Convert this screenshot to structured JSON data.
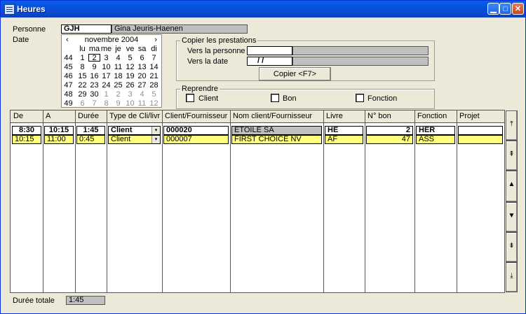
{
  "window": {
    "title": "Heures"
  },
  "form": {
    "personne_label": "Personne",
    "personne_code": "GJH",
    "personne_name": "Gina Jeuris-Haenen",
    "date_label": "Date"
  },
  "calendar": {
    "month_title": "novembre 2004",
    "prev": "‹",
    "next": "›",
    "day_headers": [
      "lu",
      "ma",
      "me",
      "je",
      "ve",
      "sa",
      "di"
    ],
    "weeks": [
      {
        "wk": "44",
        "days": [
          "1",
          "2",
          "3",
          "4",
          "5",
          "6",
          "7"
        ]
      },
      {
        "wk": "45",
        "days": [
          "8",
          "9",
          "10",
          "11",
          "12",
          "13",
          "14"
        ]
      },
      {
        "wk": "46",
        "days": [
          "15",
          "16",
          "17",
          "18",
          "19",
          "20",
          "21"
        ]
      },
      {
        "wk": "47",
        "days": [
          "22",
          "23",
          "24",
          "25",
          "26",
          "27",
          "28"
        ]
      },
      {
        "wk": "48",
        "days": [
          "29",
          "30",
          "1",
          "2",
          "3",
          "4",
          "5"
        ]
      },
      {
        "wk": "49",
        "days": [
          "6",
          "7",
          "8",
          "9",
          "10",
          "11",
          "12"
        ]
      }
    ],
    "selected_day": "2"
  },
  "copier": {
    "title": "Copier les prestations",
    "vers_personne_label": "Vers la personne",
    "vers_personne_value": "",
    "vers_date_label": "Vers la date",
    "vers_date_value": "/  /",
    "button": "Copier <F7>"
  },
  "reprendre": {
    "title": "Reprendre",
    "client": "Client",
    "bon": "Bon",
    "fonction": "Fonction"
  },
  "table": {
    "headers": [
      "De",
      "A",
      "Durée",
      "Type de Cli/livr",
      "Client/Fournisseur",
      "Nom client/Fournisseur",
      "Livre",
      "N° bon",
      "Fonction",
      "Projet"
    ],
    "rows": [
      {
        "de": "8:30",
        "a": "10:15",
        "duree": "1:45",
        "type": "Client",
        "client": "000020",
        "nom": "ETOILE SA",
        "livre": "HE",
        "bon": "2",
        "fonction": "HER",
        "projet": ""
      },
      {
        "de": "10:15",
        "a": "11:00",
        "duree": "0:45",
        "type": "Client",
        "client": "000007",
        "nom": "FIRST CHOICE NV",
        "livre": "AF",
        "bon": "47",
        "fonction": "ASS",
        "projet": ""
      }
    ]
  },
  "footer": {
    "duree_totale_label": "Durée totale",
    "duree_totale_value": "1:45"
  },
  "icons": {
    "dropdown": "▾",
    "scroll_top": "⤒",
    "page_up": "⇞",
    "up": "▲",
    "down": "▼",
    "page_down": "⇟",
    "scroll_bottom": "⤓"
  }
}
